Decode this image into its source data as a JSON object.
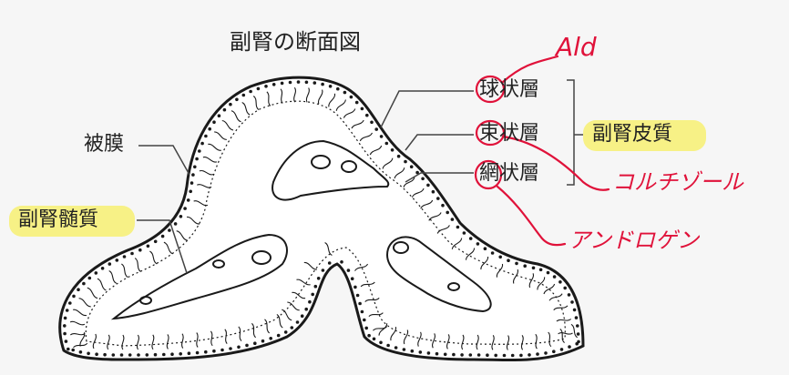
{
  "title": "副腎の断面図",
  "labels": {
    "capsule": "被膜",
    "medulla": "副腎髄質",
    "glomerulosa": "球状層",
    "fasciculata": "束状層",
    "reticularis": "網状層",
    "cortex": "副腎皮質"
  },
  "annotations": {
    "glomerulosa_hormone": "Ald",
    "fasciculata_hormone": "コルチゾール",
    "reticularis_hormone": "アンドロゲン"
  },
  "colors": {
    "ink": "#1a1a1a",
    "highlight": "#f7f17a",
    "annotation": "#e0123a",
    "background": "#f6f6f6"
  }
}
